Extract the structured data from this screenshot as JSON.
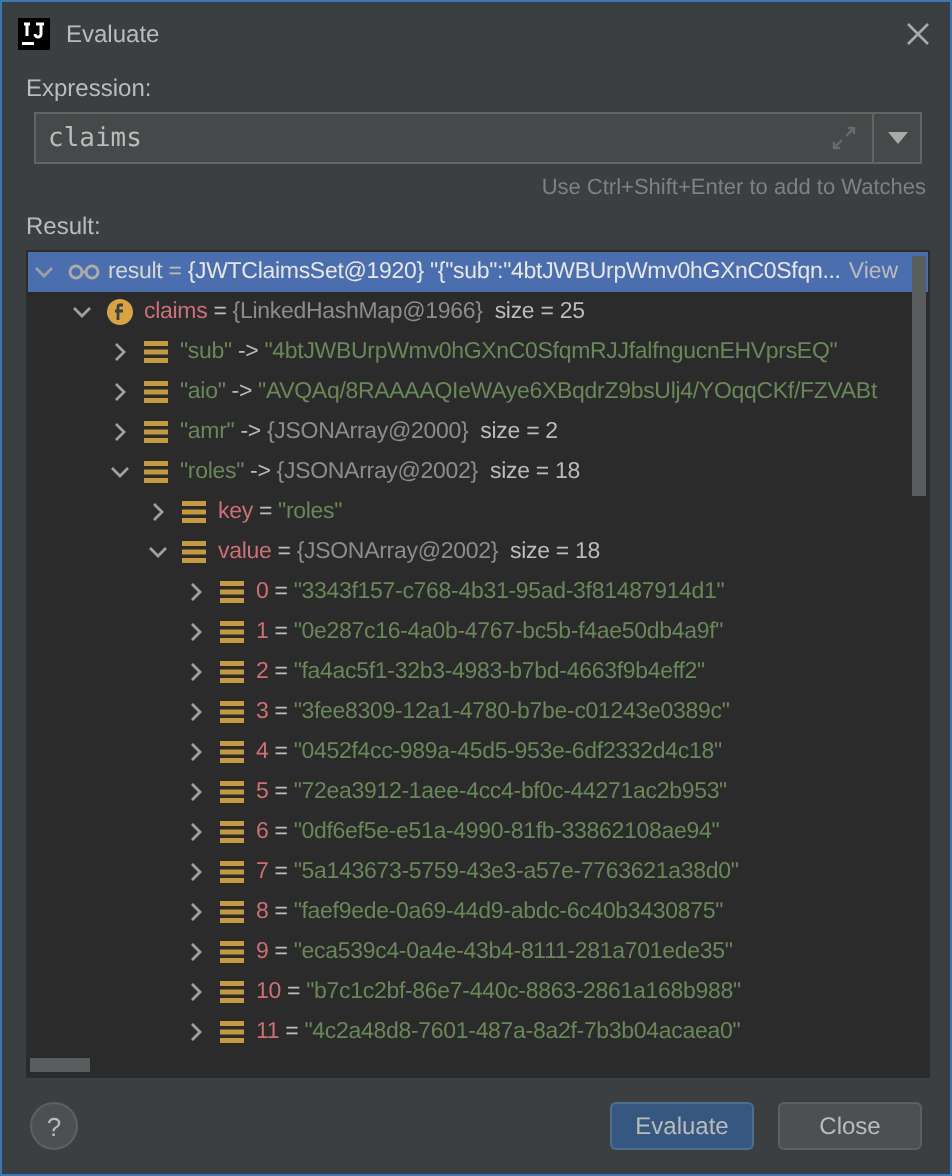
{
  "window": {
    "title": "Evaluate"
  },
  "expression": {
    "label": "Expression:",
    "value": "claims",
    "hint": "Use Ctrl+Shift+Enter to add to Watches"
  },
  "result": {
    "label": "Result:",
    "tree": [
      {
        "kind": "object",
        "name": {
          "kind": "plain",
          "text": "result"
        },
        "sep": "=",
        "value": {
          "kind": "object",
          "text": "{JWTClaimsSet@1920} \"{\"sub\":\"4btJWBUrpWmv0hGXnC0Sfqn..."
        },
        "link": "View",
        "expanded": true,
        "selected": true,
        "children": [
          {
            "kind": "field",
            "name": {
              "kind": "field",
              "text": "claims"
            },
            "sep": "=",
            "value": {
              "kind": "object",
              "text": "{LinkedHashMap@1966}"
            },
            "size": "size = 25",
            "expanded": true,
            "selected": false,
            "children": [
              {
                "kind": "entry",
                "name": {
                  "kind": "string",
                  "text": "\"sub\""
                },
                "sep": "->",
                "value": {
                  "kind": "string",
                  "text": "\"4btJWBUrpWmv0hGXnC0SfqmRJJfalfngucnEHVprsEQ\""
                },
                "expanded": false,
                "selected": false
              },
              {
                "kind": "entry",
                "name": {
                  "kind": "string",
                  "text": "\"aio\""
                },
                "sep": "->",
                "value": {
                  "kind": "string",
                  "text": "\"AVQAq/8RAAAAQIeWAye6XBqdrZ9bsUlj4/YOqqCKf/FZVABt"
                },
                "expanded": false,
                "selected": false
              },
              {
                "kind": "entry",
                "name": {
                  "kind": "string",
                  "text": "\"amr\""
                },
                "sep": "->",
                "value": {
                  "kind": "object",
                  "text": "{JSONArray@2000}"
                },
                "size": "size = 2",
                "expanded": false,
                "selected": false
              },
              {
                "kind": "entry",
                "name": {
                  "kind": "string",
                  "text": "\"roles\""
                },
                "sep": "->",
                "value": {
                  "kind": "object",
                  "text": "{JSONArray@2002}"
                },
                "size": "size = 18",
                "expanded": true,
                "selected": false,
                "children": [
                  {
                    "kind": "entry",
                    "name": {
                      "kind": "field",
                      "text": "key"
                    },
                    "sep": "=",
                    "value": {
                      "kind": "string",
                      "text": "\"roles\""
                    },
                    "expanded": false,
                    "selected": false
                  },
                  {
                    "kind": "entry",
                    "name": {
                      "kind": "field",
                      "text": "value"
                    },
                    "sep": "=",
                    "value": {
                      "kind": "object",
                      "text": "{JSONArray@2002}"
                    },
                    "size": "size = 18",
                    "expanded": true,
                    "selected": false,
                    "children": [
                      {
                        "kind": "entry",
                        "name": {
                          "kind": "field",
                          "text": "0"
                        },
                        "sep": "=",
                        "value": {
                          "kind": "string",
                          "text": "\"3343f157-c768-4b31-95ad-3f81487914d1\""
                        },
                        "expanded": false,
                        "selected": false
                      },
                      {
                        "kind": "entry",
                        "name": {
                          "kind": "field",
                          "text": "1"
                        },
                        "sep": "=",
                        "value": {
                          "kind": "string",
                          "text": "\"0e287c16-4a0b-4767-bc5b-f4ae50db4a9f\""
                        },
                        "expanded": false,
                        "selected": false
                      },
                      {
                        "kind": "entry",
                        "name": {
                          "kind": "field",
                          "text": "2"
                        },
                        "sep": "=",
                        "value": {
                          "kind": "string",
                          "text": "\"fa4ac5f1-32b3-4983-b7bd-4663f9b4eff2\""
                        },
                        "expanded": false,
                        "selected": false
                      },
                      {
                        "kind": "entry",
                        "name": {
                          "kind": "field",
                          "text": "3"
                        },
                        "sep": "=",
                        "value": {
                          "kind": "string",
                          "text": "\"3fee8309-12a1-4780-b7be-c01243e0389c\""
                        },
                        "expanded": false,
                        "selected": false
                      },
                      {
                        "kind": "entry",
                        "name": {
                          "kind": "field",
                          "text": "4"
                        },
                        "sep": "=",
                        "value": {
                          "kind": "string",
                          "text": "\"0452f4cc-989a-45d5-953e-6df2332d4c18\""
                        },
                        "expanded": false,
                        "selected": false
                      },
                      {
                        "kind": "entry",
                        "name": {
                          "kind": "field",
                          "text": "5"
                        },
                        "sep": "=",
                        "value": {
                          "kind": "string",
                          "text": "\"72ea3912-1aee-4cc4-bf0c-44271ac2b953\""
                        },
                        "expanded": false,
                        "selected": false
                      },
                      {
                        "kind": "entry",
                        "name": {
                          "kind": "field",
                          "text": "6"
                        },
                        "sep": "=",
                        "value": {
                          "kind": "string",
                          "text": "\"0df6ef5e-e51a-4990-81fb-33862108ae94\""
                        },
                        "expanded": false,
                        "selected": false
                      },
                      {
                        "kind": "entry",
                        "name": {
                          "kind": "field",
                          "text": "7"
                        },
                        "sep": "=",
                        "value": {
                          "kind": "string",
                          "text": "\"5a143673-5759-43e3-a57e-7763621a38d0\""
                        },
                        "expanded": false,
                        "selected": false
                      },
                      {
                        "kind": "entry",
                        "name": {
                          "kind": "field",
                          "text": "8"
                        },
                        "sep": "=",
                        "value": {
                          "kind": "string",
                          "text": "\"faef9ede-0a69-44d9-abdc-6c40b3430875\""
                        },
                        "expanded": false,
                        "selected": false
                      },
                      {
                        "kind": "entry",
                        "name": {
                          "kind": "field",
                          "text": "9"
                        },
                        "sep": "=",
                        "value": {
                          "kind": "string",
                          "text": "\"eca539c4-0a4e-43b4-8111-281a701ede35\""
                        },
                        "expanded": false,
                        "selected": false
                      },
                      {
                        "kind": "entry",
                        "name": {
                          "kind": "field",
                          "text": "10"
                        },
                        "sep": "=",
                        "value": {
                          "kind": "string",
                          "text": "\"b7c1c2bf-86e7-440c-8863-2861a168b988\""
                        },
                        "expanded": false,
                        "selected": false
                      },
                      {
                        "kind": "entry",
                        "name": {
                          "kind": "field",
                          "text": "11"
                        },
                        "sep": "=",
                        "value": {
                          "kind": "string",
                          "text": "\"4c2a48d8-7601-487a-8a2f-7b3b04acaea0\""
                        },
                        "expanded": false,
                        "selected": false
                      }
                    ]
                  }
                ]
              }
            ]
          }
        ]
      }
    ]
  },
  "footer": {
    "help": "?",
    "buttons": [
      {
        "label": "Evaluate",
        "primary": true
      },
      {
        "label": "Close",
        "primary": false
      }
    ]
  }
}
